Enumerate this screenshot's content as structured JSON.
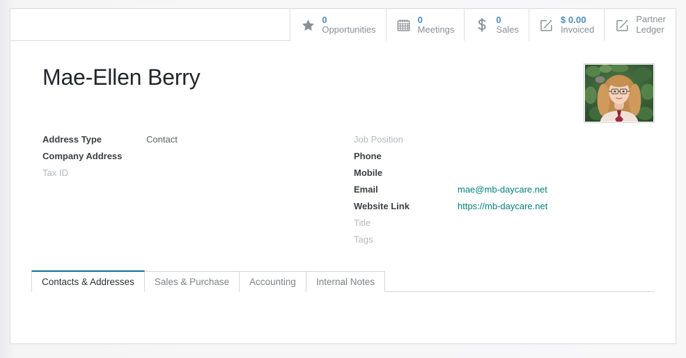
{
  "stat_buttons": [
    {
      "name": "opportunities",
      "value": "0",
      "label": "Opportunities",
      "icon": "star-icon"
    },
    {
      "name": "meetings",
      "value": "0",
      "label": "Meetings",
      "icon": "calendar-icon"
    },
    {
      "name": "sales",
      "value": "0",
      "label": "Sales",
      "icon": "dollar-sign-icon"
    },
    {
      "name": "invoiced",
      "value": "$ 0.00",
      "label": "Invoiced",
      "icon": "pencil-square-icon"
    },
    {
      "name": "partner-ledger",
      "value": "",
      "label": "Partner\nLedger",
      "icon": "pencil-square-icon"
    }
  ],
  "record": {
    "title": "Mae-Ellen Berry",
    "avatar_alt": "Mae-Ellen Berry"
  },
  "left_fields": [
    {
      "label": "Address Type",
      "value": "Contact",
      "empty": false,
      "link": false
    },
    {
      "label": "Company Address",
      "value": "",
      "empty": false,
      "link": false
    },
    {
      "label": "Tax ID",
      "value": "",
      "empty": true,
      "link": false
    }
  ],
  "right_fields": [
    {
      "label": "Job Position",
      "value": "",
      "empty": true,
      "link": false
    },
    {
      "label": "Phone",
      "value": "",
      "empty": false,
      "link": false
    },
    {
      "label": "Mobile",
      "value": "",
      "empty": false,
      "link": false
    },
    {
      "label": "Email",
      "value": "mae@mb-daycare.net",
      "empty": false,
      "link": true
    },
    {
      "label": "Website Link",
      "value": "https://mb-daycare.net",
      "empty": false,
      "link": true
    },
    {
      "label": "Title",
      "value": "",
      "empty": true,
      "link": false
    },
    {
      "label": "Tags",
      "value": "",
      "empty": true,
      "link": false
    }
  ],
  "tabs": [
    {
      "label": "Contacts & Addresses",
      "active": true
    },
    {
      "label": "Sales & Purchase",
      "active": false
    },
    {
      "label": "Accounting",
      "active": false
    },
    {
      "label": "Internal Notes",
      "active": false
    }
  ],
  "colors": {
    "stat_value": "#4b8bbe",
    "link": "#00807b",
    "active_tab_accent": "#0b6e99",
    "label": "#3c4043",
    "empty_label": "#b4b8bc"
  }
}
